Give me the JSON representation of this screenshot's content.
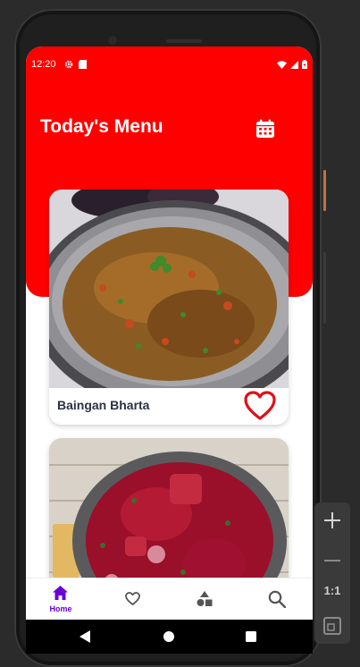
{
  "status_bar": {
    "time": "12:20"
  },
  "header": {
    "title": "Today's Menu"
  },
  "menu_items": [
    {
      "name": "Baingan Bharta"
    },
    {
      "name": ""
    }
  ],
  "bottom_nav": {
    "items": [
      {
        "id": "home",
        "label": "Home",
        "active": true
      },
      {
        "id": "favorites",
        "label": "",
        "active": false
      },
      {
        "id": "categories",
        "label": "",
        "active": false
      },
      {
        "id": "search",
        "label": "",
        "active": false
      }
    ]
  },
  "emulator_panel": {
    "zoom_label": "1:1"
  },
  "colors": {
    "header_red": "#ff0000",
    "heart_red": "#e0101a",
    "nav_active": "#6a00d8",
    "nav_inactive": "#555555",
    "title_dark": "#2b3245"
  }
}
